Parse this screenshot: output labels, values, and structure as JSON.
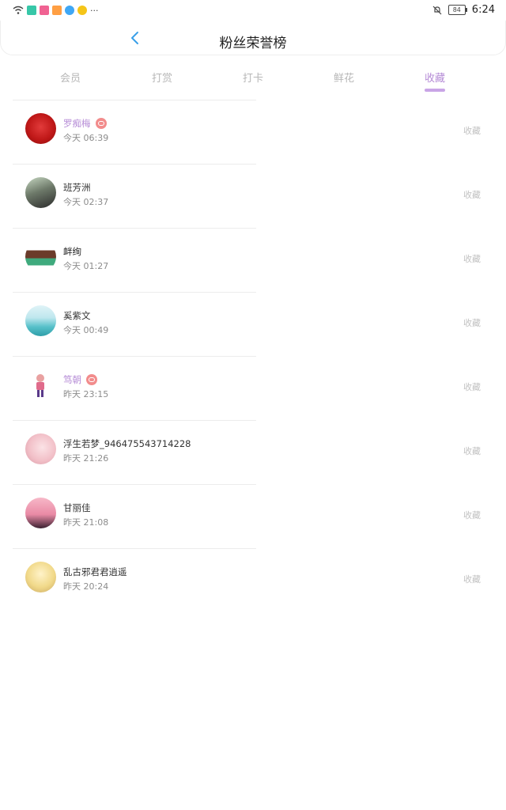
{
  "status_bar": {
    "time": "6:24",
    "battery": "84",
    "left_icons": [
      "wifi-icon",
      "app-icon-green",
      "app-icon-pink",
      "app-icon-orange",
      "app-icon-blue",
      "app-icon-yellow"
    ],
    "more": "···"
  },
  "header": {
    "title": "粉丝荣誉榜"
  },
  "tabs": [
    {
      "label": "会员"
    },
    {
      "label": "打赏"
    },
    {
      "label": "打卡"
    },
    {
      "label": "鲜花"
    },
    {
      "label": "收藏"
    }
  ],
  "active_tab": 4,
  "fans": [
    {
      "name": "罗痴梅",
      "time": "今天 06:39",
      "vip": true,
      "action": "收藏"
    },
    {
      "name": "班芳洲",
      "time": "今天 02:37",
      "vip": false,
      "action": "收藏"
    },
    {
      "name": "衅绚",
      "time": "今天 01:27",
      "vip": false,
      "action": "收藏"
    },
    {
      "name": "奚紫文",
      "time": "今天 00:49",
      "vip": false,
      "action": "收藏"
    },
    {
      "name": "笃朝",
      "time": "昨天 23:15",
      "vip": true,
      "action": "收藏"
    },
    {
      "name": "浮生若梦_946475543714228",
      "time": "昨天 21:26",
      "vip": false,
      "action": "收藏"
    },
    {
      "name": "甘丽佳",
      "time": "昨天 21:08",
      "vip": false,
      "action": "收藏"
    },
    {
      "name": "乱古邪君君逍遥",
      "time": "昨天 20:24",
      "vip": false,
      "action": "收藏"
    }
  ],
  "colors": {
    "accent": "#b58bd6",
    "inactive_tab": "#b7b7b7",
    "vip_badge": "#f28c8c"
  }
}
